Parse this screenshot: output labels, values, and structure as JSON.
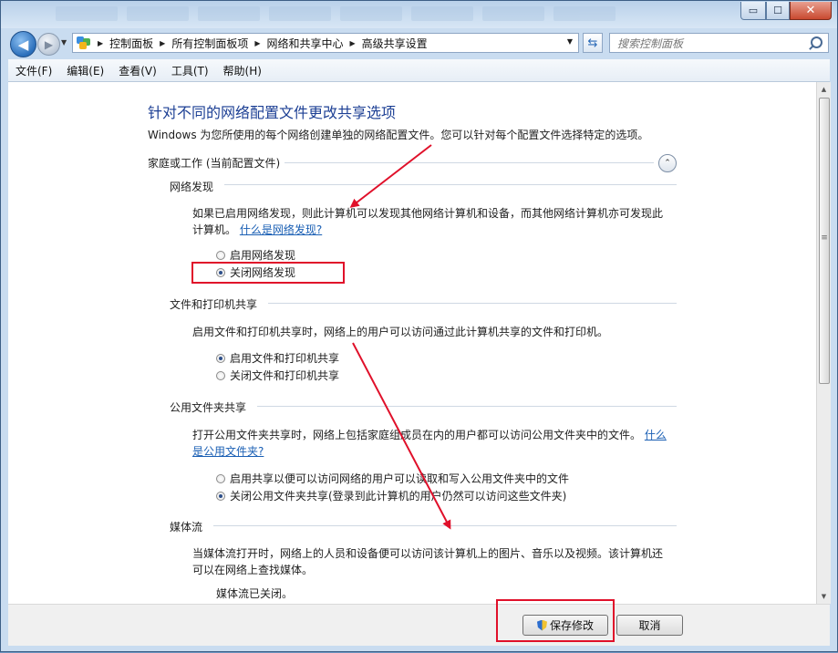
{
  "window": {
    "controls": {
      "minimize": "▭",
      "maximize": "☐",
      "close": "✕"
    }
  },
  "nav": {
    "back": "◀",
    "forward": "▶",
    "breadcrumbs": [
      "控制面板",
      "所有控制面板项",
      "网络和共享中心",
      "高级共享设置"
    ],
    "search_placeholder": "搜索控制面板"
  },
  "menu": [
    "文件(F)",
    "编辑(E)",
    "查看(V)",
    "工具(T)",
    "帮助(H)"
  ],
  "content": {
    "title": "针对不同的网络配置文件更改共享选项",
    "intro": "Windows 为您所使用的每个网络创建单独的网络配置文件。您可以针对每个配置文件选择特定的选项。",
    "profile_header": "家庭或工作 (当前配置文件)",
    "collapse_icon": "⌃",
    "network_discovery": {
      "heading": "网络发现",
      "desc": "如果已启用网络发现，则此计算机可以发现其他网络计算机和设备，而其他网络计算机亦可发现此计算机。",
      "link": "什么是网络发现?",
      "options": [
        "启用网络发现",
        "关闭网络发现"
      ],
      "selected": 1
    },
    "file_printer": {
      "heading": "文件和打印机共享",
      "desc": "启用文件和打印机共享时，网络上的用户可以访问通过此计算机共享的文件和打印机。",
      "options": [
        "启用文件和打印机共享",
        "关闭文件和打印机共享"
      ],
      "selected": 0
    },
    "public_folder": {
      "heading": "公用文件夹共享",
      "desc": "打开公用文件夹共享时，网络上包括家庭组成员在内的用户都可以访问公用文件夹中的文件。",
      "link": "什么是公用文件夹?",
      "options": [
        "启用共享以便可以访问网络的用户可以读取和写入公用文件夹中的文件",
        "关闭公用文件夹共享(登录到此计算机的用户仍然可以访问这些文件夹)"
      ],
      "selected": 1
    },
    "media": {
      "heading": "媒体流",
      "desc": "当媒体流打开时，网络上的人员和设备便可以访问该计算机上的图片、音乐以及视频。该计算机还可以在网络上查找媒体。",
      "status": "媒体流已关闭。"
    }
  },
  "buttons": {
    "save": "保存修改",
    "cancel": "取消"
  },
  "colors": {
    "annotation": "#e0102a",
    "title": "#1c3f94",
    "link": "#1a5fb4"
  }
}
